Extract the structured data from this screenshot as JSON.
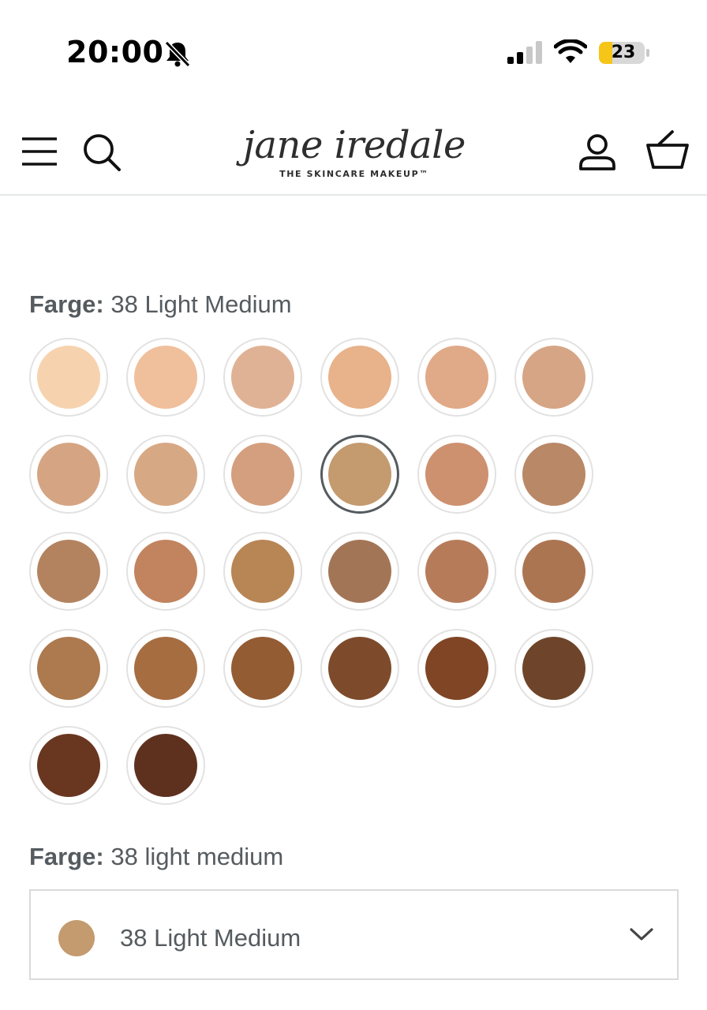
{
  "status_bar": {
    "time": "20:00",
    "battery": "23",
    "icons": [
      "bell-muted-icon",
      "signal-icon",
      "wifi-icon",
      "battery-icon"
    ]
  },
  "header": {
    "brand": "jane iredale",
    "tagline": "THE SKINCARE MAKEUP™",
    "icons": [
      "menu-icon",
      "search-icon",
      "account-icon",
      "basket-icon"
    ]
  },
  "color_label": {
    "prefix": "Farge:",
    "value": "38 Light Medium"
  },
  "swatches": [
    {
      "color": "#f6d3ae",
      "selected": false
    },
    {
      "color": "#f0bf9b",
      "selected": false
    },
    {
      "color": "#e0b295",
      "selected": false
    },
    {
      "color": "#e8b28a",
      "selected": false
    },
    {
      "color": "#e0a987",
      "selected": false
    },
    {
      "color": "#d6a585",
      "selected": false
    },
    {
      "color": "#d5a583",
      "selected": false
    },
    {
      "color": "#d7a884",
      "selected": false
    },
    {
      "color": "#d49f7e",
      "selected": false
    },
    {
      "color": "#c49a6f",
      "selected": true
    },
    {
      "color": "#cd9170",
      "selected": false
    },
    {
      "color": "#b98867",
      "selected": false
    },
    {
      "color": "#b3835f",
      "selected": false
    },
    {
      "color": "#c1845e",
      "selected": false
    },
    {
      "color": "#b88554",
      "selected": false
    },
    {
      "color": "#a37557",
      "selected": false
    },
    {
      "color": "#b67c5a",
      "selected": false
    },
    {
      "color": "#ac7552",
      "selected": false
    },
    {
      "color": "#ac7a4e",
      "selected": false
    },
    {
      "color": "#a66d41",
      "selected": false
    },
    {
      "color": "#945c33",
      "selected": false
    },
    {
      "color": "#7d4b2b",
      "selected": false
    },
    {
      "color": "#7f4524",
      "selected": false
    },
    {
      "color": "#6e452a",
      "selected": false
    },
    {
      "color": "#693620",
      "selected": false
    },
    {
      "color": "#5e311f",
      "selected": false
    }
  ],
  "color_label_2": {
    "prefix": "Farge:",
    "value": "38 light medium"
  },
  "select": {
    "value": "38 Light Medium",
    "swatch_color": "#c49a6f"
  }
}
